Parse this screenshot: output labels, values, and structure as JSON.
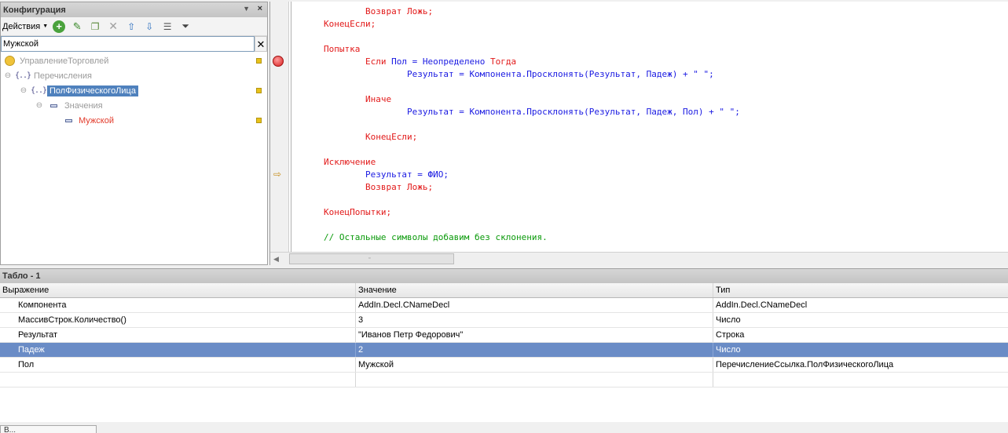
{
  "config_panel": {
    "title": "Конфигурация",
    "pin_icon": "pin-icon",
    "close_label": "×",
    "actions_label": "Действия",
    "search_value": "Мужской",
    "clear_label": "✕",
    "tree": [
      {
        "label": "УправлениеТорговлей"
      },
      {
        "label": "Перечисления"
      },
      {
        "label": "ПолФизическогоЛица"
      },
      {
        "label": "Значения"
      },
      {
        "label": "Мужской"
      }
    ]
  },
  "code": {
    "lines": [
      {
        "indent": "        ",
        "parts": [
          {
            "t": "Возврат Ложь;",
            "k": "kw"
          }
        ]
      },
      {
        "indent": "",
        "parts": [
          {
            "t": "КонецЕсли;",
            "k": "kw"
          }
        ]
      },
      {
        "indent": "",
        "parts": []
      },
      {
        "indent": "",
        "parts": [
          {
            "t": "Попытка",
            "k": "kw"
          }
        ]
      },
      {
        "indent": "        ",
        "parts": [
          {
            "t": "Если ",
            "k": "kw"
          },
          {
            "t": "Пол = Неопределено ",
            "k": "id"
          },
          {
            "t": "Тогда",
            "k": "kw"
          }
        ]
      },
      {
        "indent": "                ",
        "parts": [
          {
            "t": "Результат = Компонента.Просклонять(Результат, Падеж) + \" \";",
            "k": "id"
          }
        ]
      },
      {
        "indent": "",
        "parts": []
      },
      {
        "indent": "        ",
        "parts": [
          {
            "t": "Иначе",
            "k": "kw"
          }
        ]
      },
      {
        "indent": "                ",
        "parts": [
          {
            "t": "Результат = Компонента.Просклонять(Результат, Падеж, Пол) + \" \";",
            "k": "id"
          }
        ]
      },
      {
        "indent": "",
        "parts": []
      },
      {
        "indent": "        ",
        "parts": [
          {
            "t": "КонецЕсли;",
            "k": "kw"
          }
        ]
      },
      {
        "indent": "",
        "parts": []
      },
      {
        "indent": "",
        "parts": [
          {
            "t": "Исключение",
            "k": "kw"
          }
        ]
      },
      {
        "indent": "        ",
        "parts": [
          {
            "t": "Результат = ФИО;",
            "k": "id"
          }
        ]
      },
      {
        "indent": "        ",
        "parts": [
          {
            "t": "Возврат Ложь;",
            "k": "kw"
          }
        ]
      },
      {
        "indent": "",
        "parts": []
      },
      {
        "indent": "",
        "parts": [
          {
            "t": "КонецПопытки;",
            "k": "kw"
          }
        ]
      },
      {
        "indent": "",
        "parts": []
      },
      {
        "indent": "",
        "parts": [
          {
            "t": "// Остальные символы добавим без склонения.",
            "k": "cm"
          }
        ]
      }
    ]
  },
  "tablo": {
    "title": "Табло - 1",
    "columns": [
      "Выражение",
      "Значение",
      "Тип"
    ],
    "rows": [
      [
        "Компонента",
        "AddIn.Decl.CNameDecl",
        "AddIn.Decl.CNameDecl"
      ],
      [
        "МассивСтрок.Количество()",
        "3",
        "Число"
      ],
      [
        "Результат",
        "\"Иванов Петр Федорович\"",
        "Строка"
      ],
      [
        "Падеж",
        "2",
        "Число"
      ],
      [
        "Пол",
        "Мужской",
        "ПеречислениеСсылка.ПолФизическогоЛица"
      ],
      [
        "",
        "",
        ""
      ]
    ],
    "selected_row": 3
  },
  "bottom_tab_label": "В...",
  "colors": {
    "keyword": "#e21a1a",
    "identifier": "#1a1ae2",
    "comment": "#0a9a0a",
    "selection": "#6a8cc6"
  }
}
